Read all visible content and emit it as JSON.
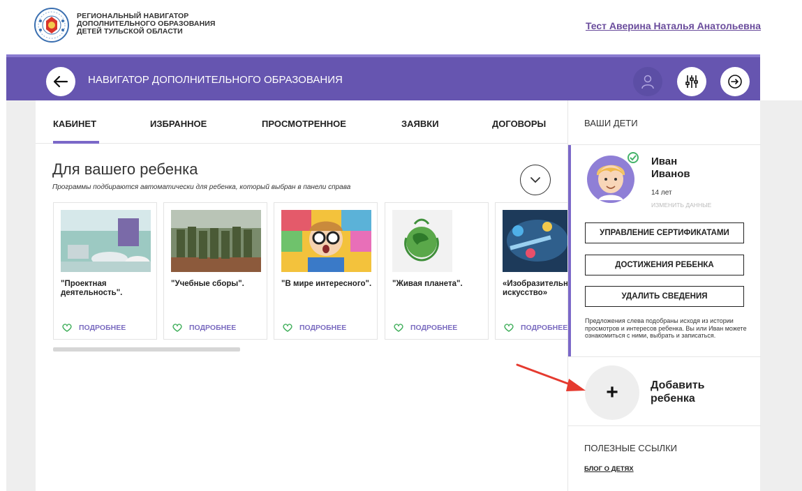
{
  "header": {
    "logo_lines": [
      "РЕГИОНАЛЬНЫЙ НАВИГАТОР",
      "ДОПОЛНИТЕЛЬНОГО ОБРАЗОВАНИЯ",
      "ДЕТЕЙ ТУЛЬСКОЙ ОБЛАСТИ"
    ],
    "user_name": "Тест Аверина Наталья Анатольевна"
  },
  "navbar": {
    "title": "НАВИГАТОР ДОПОЛНИТЕЛЬНОГО ОБРАЗОВАНИЯ",
    "icons": [
      "back-arrow-icon",
      "user-icon",
      "filter-sliders-icon",
      "logout-arrow-icon"
    ],
    "bar_color": "#6655b0"
  },
  "tabs": [
    {
      "label": "КАБИНЕТ",
      "active": true
    },
    {
      "label": "ИЗБРАННОЕ"
    },
    {
      "label": "ПРОСМОТРЕННОЕ"
    },
    {
      "label": "ЗАЯВКИ"
    },
    {
      "label": "ДОГОВОРЫ"
    }
  ],
  "section": {
    "title": "Для вашего ребенка",
    "subtitle": "Программы подбираются автоматически для ребенка, который выбран в панели справа"
  },
  "cards": [
    {
      "title": "\"Проектная деятельность\".",
      "more": "ПОДРОБНЕЕ",
      "image": "classroom-photo"
    },
    {
      "title": "\"Учебные сборы\".",
      "more": "ПОДРОБНЕЕ",
      "image": "soldiers-photo"
    },
    {
      "title": "\"В мире интересного\".",
      "more": "ПОДРОБНЕЕ",
      "image": "boy-question-marks-photo"
    },
    {
      "title": "\"Живая планета\".",
      "more": "ПОДРОБНЕЕ",
      "image": "green-globe-icon"
    },
    {
      "title": "«Изобразительное искусство»",
      "more": "ПОДРОБНЕЕ",
      "image": "paint-palette-photo"
    }
  ],
  "sidebar": {
    "heading": "ВАШИ ДЕТИ",
    "child": {
      "first_name": "Иван",
      "last_name": "Иванов",
      "age": "14 лет",
      "edit_label": "ИЗМЕНИТЬ ДАННЫЕ"
    },
    "buttons": [
      "УПРАВЛЕНИЕ СЕРТИФИКАТАМИ",
      "ДОСТИЖЕНИЯ РЕБЕНКА",
      "УДАЛИТЬ СВЕДЕНИЯ"
    ],
    "note": "Предложения слева подобраны исходя из истории просмотров и интересов ребенка. Вы или Иван можете ознакомиться с ними, выбрать и записаться.",
    "add_child": {
      "icon": "+",
      "label": "Добавить ребенка"
    },
    "links_heading": "ПОЛЕЗНЫЕ ССЫЛКИ",
    "blog_link": "БЛОГ О ДЕТЯХ"
  }
}
